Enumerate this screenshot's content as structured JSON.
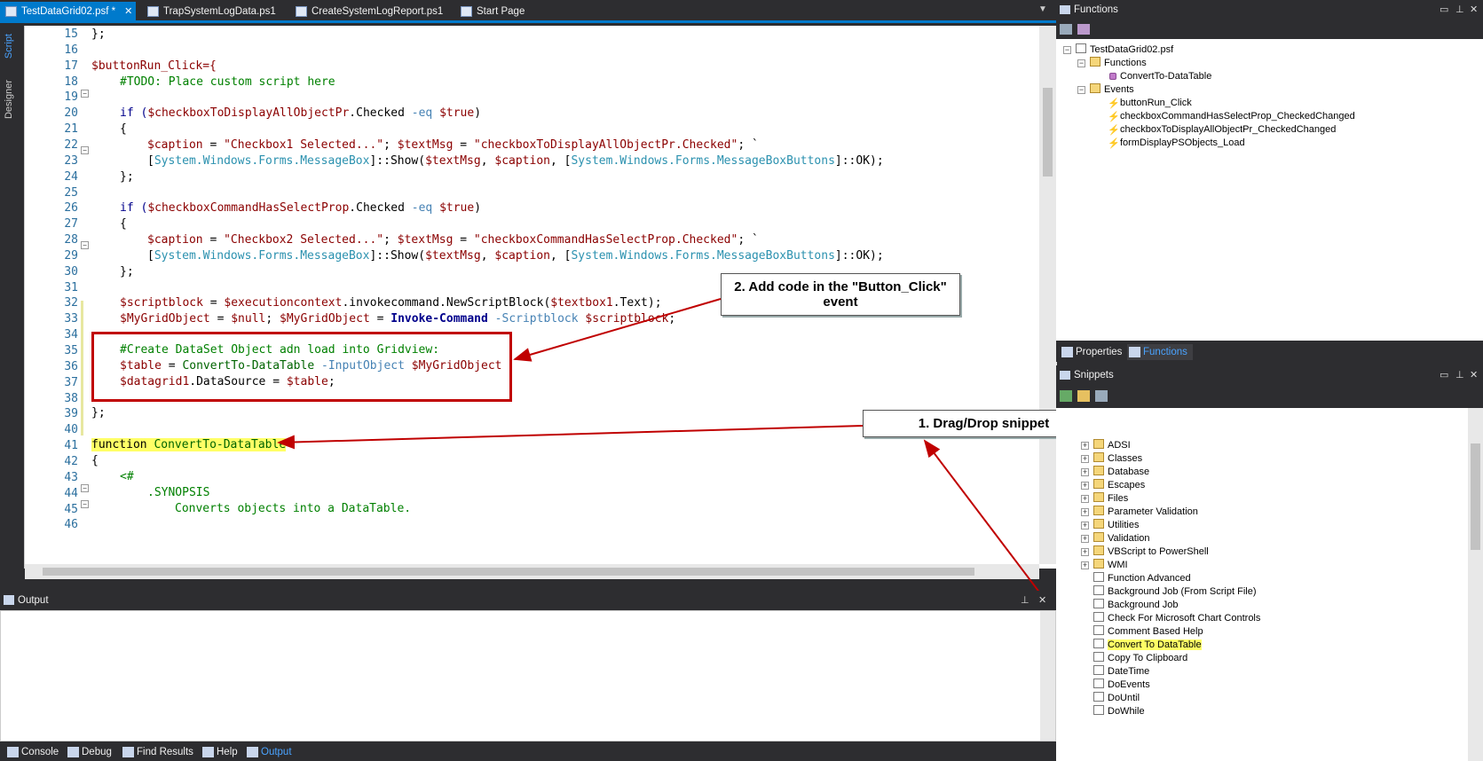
{
  "tabs": [
    {
      "label": "TestDataGrid02.psf *",
      "close": "✕"
    },
    {
      "label": "TrapSystemLogData.ps1"
    },
    {
      "label": "CreateSystemLogReport.ps1"
    },
    {
      "label": "Start Page"
    }
  ],
  "vtabs": {
    "script": "Script",
    "designer": "Designer"
  },
  "code": {
    "line_numbers": [
      "15",
      "16",
      "17",
      "18",
      "19",
      "20",
      "21",
      "22",
      "23",
      "24",
      "25",
      "26",
      "27",
      "28",
      "29",
      "30",
      "31",
      "32",
      "33",
      "34",
      "35",
      "36",
      "37",
      "38",
      "39",
      "40",
      "41",
      "42",
      "43",
      "44",
      "45",
      "46"
    ],
    "l15": "};",
    "l17": "$buttonRun_Click={",
    "l18": "#TODO: Place custom script here",
    "l20a": "if (",
    "l20b": "$checkboxToDisplayAllObjectPr",
    ".l20c": "",
    "l20d": ".Checked ",
    "l20e": "-eq ",
    "l20f": "$true",
    "l20g": ")",
    "brace_open": "{",
    "brace_close_semi": "};",
    "l22a": "$caption",
    " l22b": " = ",
    "l22c": "\"Checkbox1 Selected...\"",
    "l22d": "; ",
    "l22e": "$textMsg",
    "l22f": "\"checkboxToDisplayAllObjectPr.Checked\"",
    "l22g": "; `",
    "l23a": "[",
    "l23b": "System.Windows.Forms.MessageBox",
    "l23c": "]::Show(",
    "l23d": "$textMsg",
    ",l23e": "",
    "l23f": "$caption",
    "l23g": ", [",
    "l23h": "System.Windows.Forms.MessageBoxButtons",
    "l23i": "]::OK);",
    "l26b": "$checkboxCommandHasSelectProp",
    "l28c": "\"Checkbox2 Selected...\"",
    "l28f": "\"checkboxCommandHasSelectProp.Checked\"",
    "l32a": "$scriptblock",
    "l32b": " = ",
    "l32c": "$executioncontext",
    ".l32d": "",
    "l32e": ".invokecommand.NewScriptBlock(",
    "l32f": "$textbox1",
    ".l32g": "",
    "l32h": ".Text);",
    "l33a": "$MyGridObject",
    "l33b": " = ",
    "l33c": "$null",
    "l33d": "; ",
    "l33f": "Invoke-Command",
    "l33g": " -Scriptblock ",
    "l33h": "$scriptblock",
    "l33i": ";",
    "l35": "#Create DataSet Object adn load into Gridview:",
    "l36a": "$table",
    "l36c": "ConvertTo-DataTable",
    "l36d": " -InputObject ",
    "l36e": "$MyGridObject",
    "l37a": "$datagrid1",
    "l37b": ".DataSource = ",
    "l37c": "$table",
    "l37d": ";",
    "l41a": "function ",
    "l41b": "ConvertTo-DataTable",
    "l43": "<#",
    "l44": ".SYNOPSIS",
    "l45": "Converts objects into a DataTable."
  },
  "callouts": {
    "step2": "2. Add code in the \"Button_Click\" event",
    "step1": "1. Drag/Drop snippet"
  },
  "output": {
    "title": "Output"
  },
  "bottom_tabs": [
    "Console",
    "Debug",
    "Find Results",
    "Help",
    "Output"
  ],
  "functions_panel": {
    "title": "Functions",
    "root": "TestDataGrid02.psf",
    "functions_folder": "Functions",
    "functions": [
      "ConvertTo-DataTable"
    ],
    "events_folder": "Events",
    "events": [
      "buttonRun_Click",
      "checkboxCommandHasSelectProp_CheckedChanged",
      "checkboxToDisplayAllObjectPr_CheckedChanged",
      "formDisplayPSObjects_Load"
    ]
  },
  "mid_tabs": [
    "Properties",
    "Functions"
  ],
  "snippets_panel": {
    "title": "Snippets",
    "folders": [
      "ADSI",
      "Classes",
      "Database",
      "Escapes",
      "Files",
      "Parameter Validation",
      "Utilities",
      "Validation",
      "VBScript to PowerShell",
      "WMI"
    ],
    "items": [
      "Function Advanced",
      "Background Job (From Script File)",
      "Background Job",
      "Check For Microsoft Chart Controls",
      "Comment Based Help",
      "Convert To DataTable",
      "Copy To Clipboard",
      "DateTime",
      "DoEvents",
      "DoUntil",
      "DoWhile"
    ]
  },
  "colors": {
    "accent": "#007acc",
    "highlight": "#ffff66",
    "annotation_red": "#c00000"
  }
}
